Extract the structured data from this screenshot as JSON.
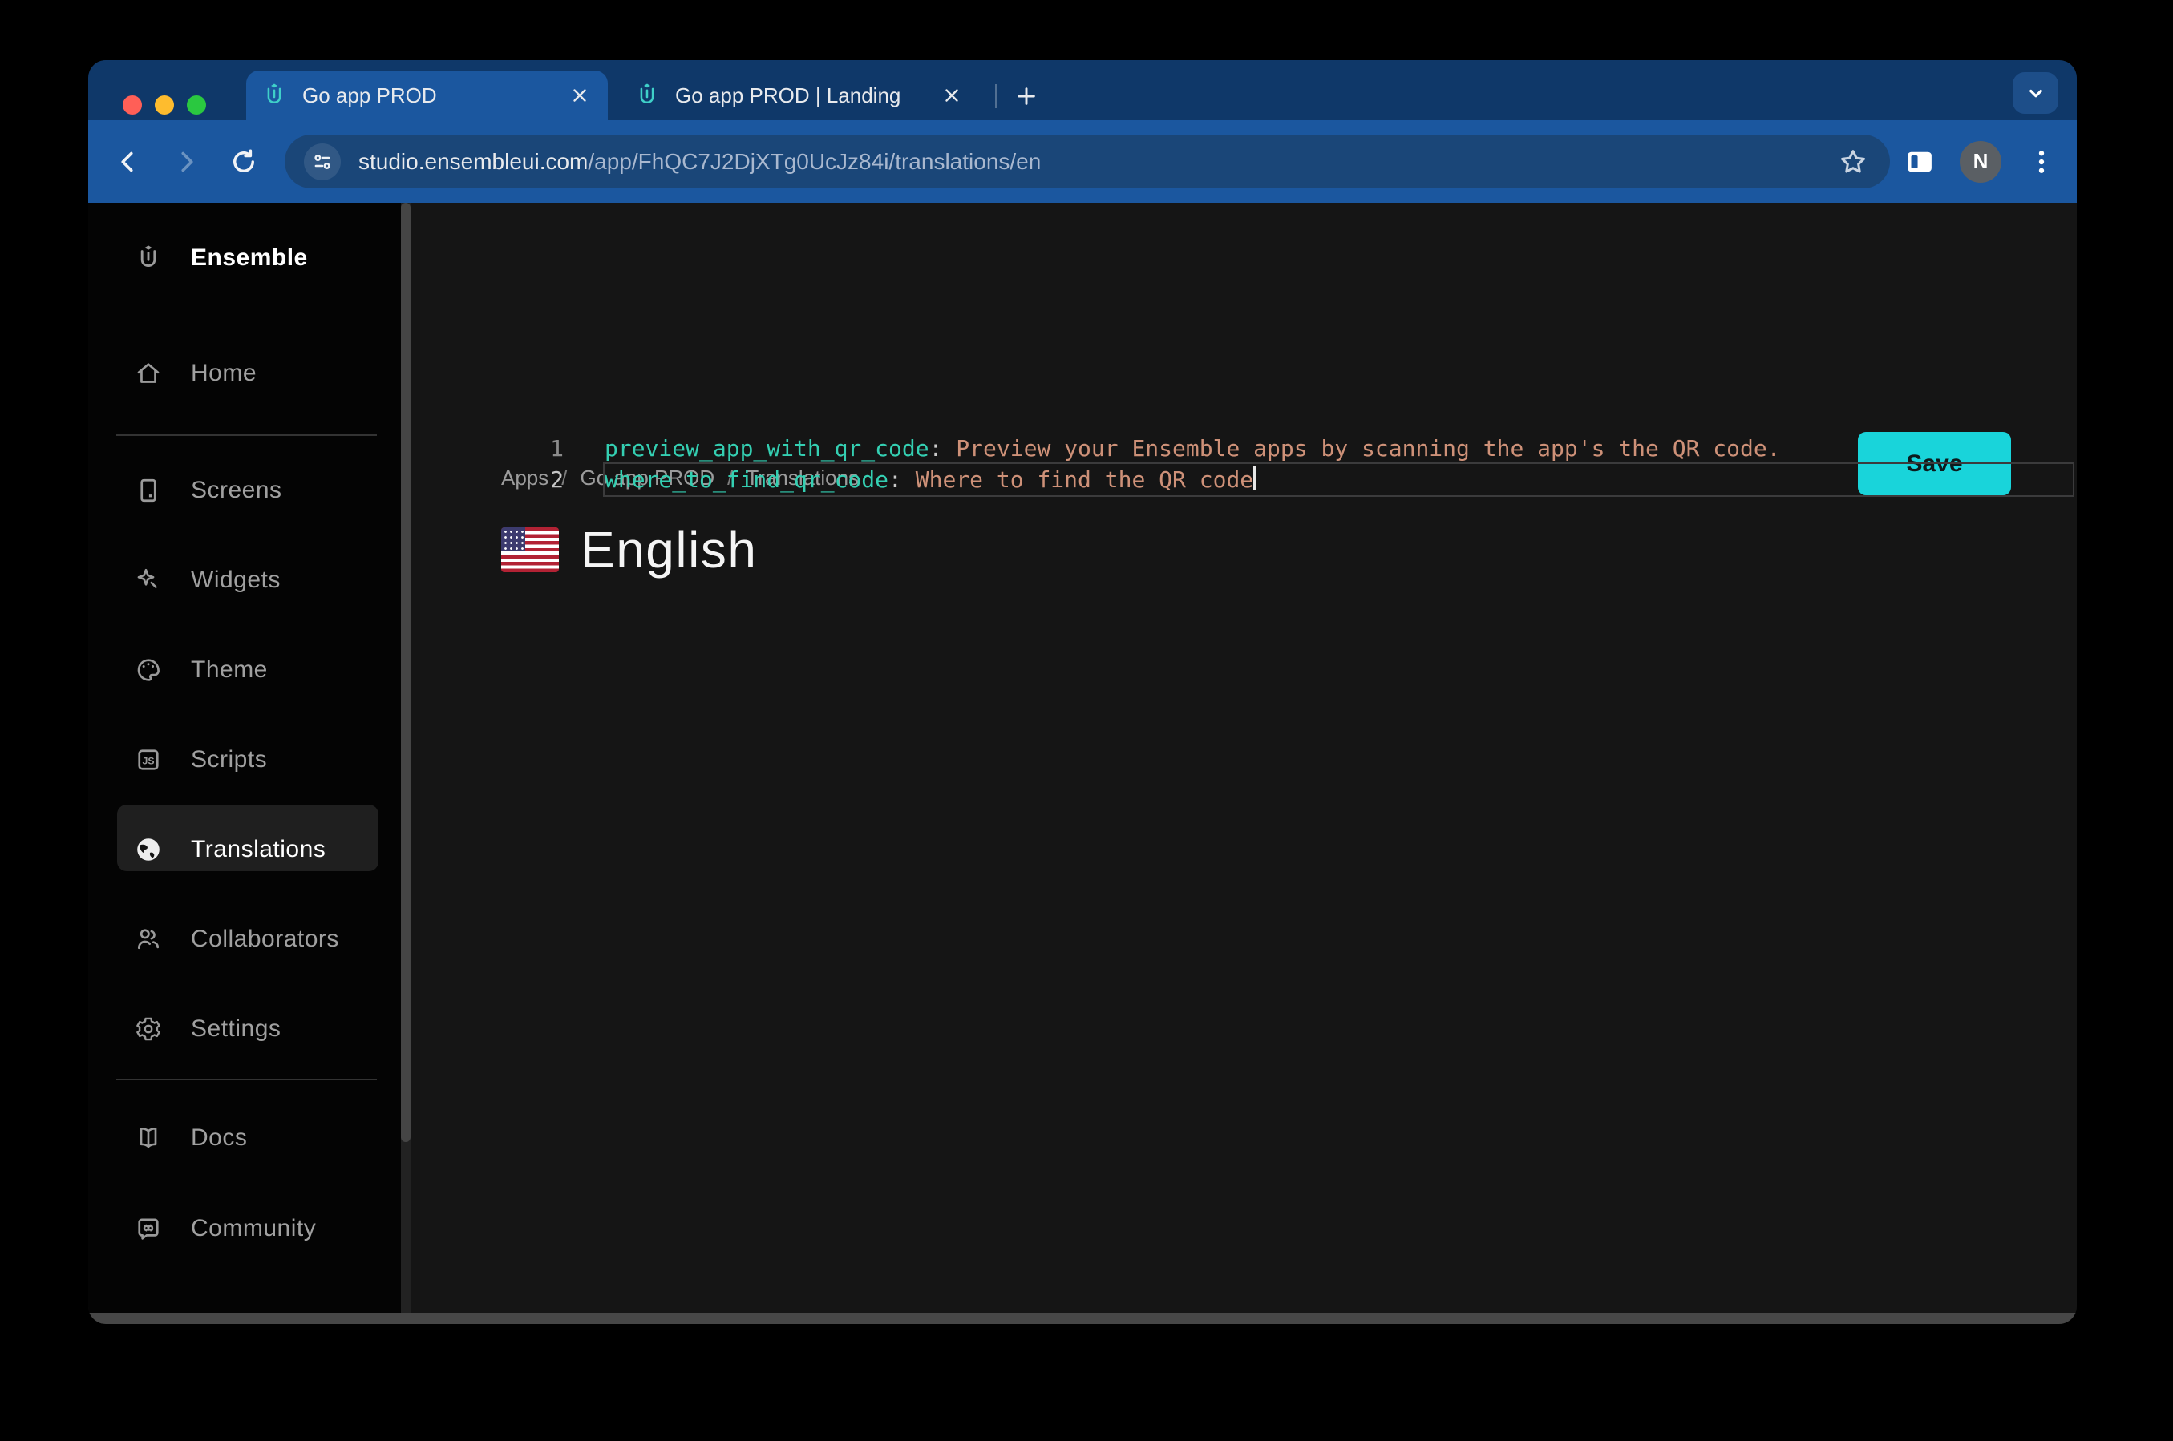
{
  "colors": {
    "tabstrip_bg": "#0f3869",
    "toolbar_bg": "#1b579f",
    "omnibox_bg": "#1a4678",
    "window_bg": "#141414",
    "sidebar_bg": "#040404",
    "content_bg": "#151515",
    "accent": "#19d4da",
    "save_text": "#0c1b1d",
    "key_color": "#34cfb2",
    "value_color": "#ce9178",
    "punct_color": "#c9c9c9",
    "linenum": "#8b8b8b",
    "linenum_active": "#c6c6c6",
    "active_line_border": "#3b3b3c",
    "sidebar_text": "#a0a0a0",
    "sidebar_text_active": "#ffffff",
    "breadcrumb": "#9b9b9b",
    "tab_text": "#e8eaed",
    "favicon_teal": "#3fd0c9",
    "tl_red": "#ff5f57",
    "tl_yellow": "#febc2e",
    "tl_green": "#2ac840"
  },
  "browser": {
    "tabs": [
      {
        "title": "Go app PROD",
        "active": true
      },
      {
        "title": "Go app PROD | Landing",
        "active": false
      }
    ],
    "url": {
      "domain": "studio.ensembleui.com",
      "path": "/app/FhQC7J2DjXTg0UcJz84i/translations/en"
    },
    "avatar_initial": "N"
  },
  "sidebar": {
    "logo_label": "Ensemble",
    "items": [
      {
        "label": "Home",
        "icon": "home-icon",
        "selected": false
      },
      {
        "label": "Screens",
        "icon": "screens-icon",
        "selected": false
      },
      {
        "label": "Widgets",
        "icon": "widgets-icon",
        "selected": false
      },
      {
        "label": "Theme",
        "icon": "theme-icon",
        "selected": false
      },
      {
        "label": "Scripts",
        "icon": "scripts-icon",
        "selected": false
      },
      {
        "label": "Translations",
        "icon": "translations-icon",
        "selected": true
      },
      {
        "label": "Collaborators",
        "icon": "collaborators-icon",
        "selected": false
      },
      {
        "label": "Settings",
        "icon": "settings-icon",
        "selected": false
      },
      {
        "label": "Docs",
        "icon": "docs-icon",
        "selected": false
      },
      {
        "label": "Community",
        "icon": "community-icon",
        "selected": false
      }
    ]
  },
  "content": {
    "breadcrumb": [
      "Apps",
      "Go app PROD",
      "Translations"
    ],
    "separator": "/",
    "flag_icon": "us-flag-icon",
    "title": "English",
    "save_label": "Save"
  },
  "editor": {
    "lines": [
      {
        "number": "1",
        "key": "preview_app_with_qr_code",
        "punct": ":",
        "value": " Preview your Ensemble apps by scanning the app's the QR code.",
        "active": false
      },
      {
        "number": "2",
        "key": "where_to_find_qr_code",
        "punct": ":",
        "value": " Where to find the QR code",
        "active": true
      }
    ]
  }
}
